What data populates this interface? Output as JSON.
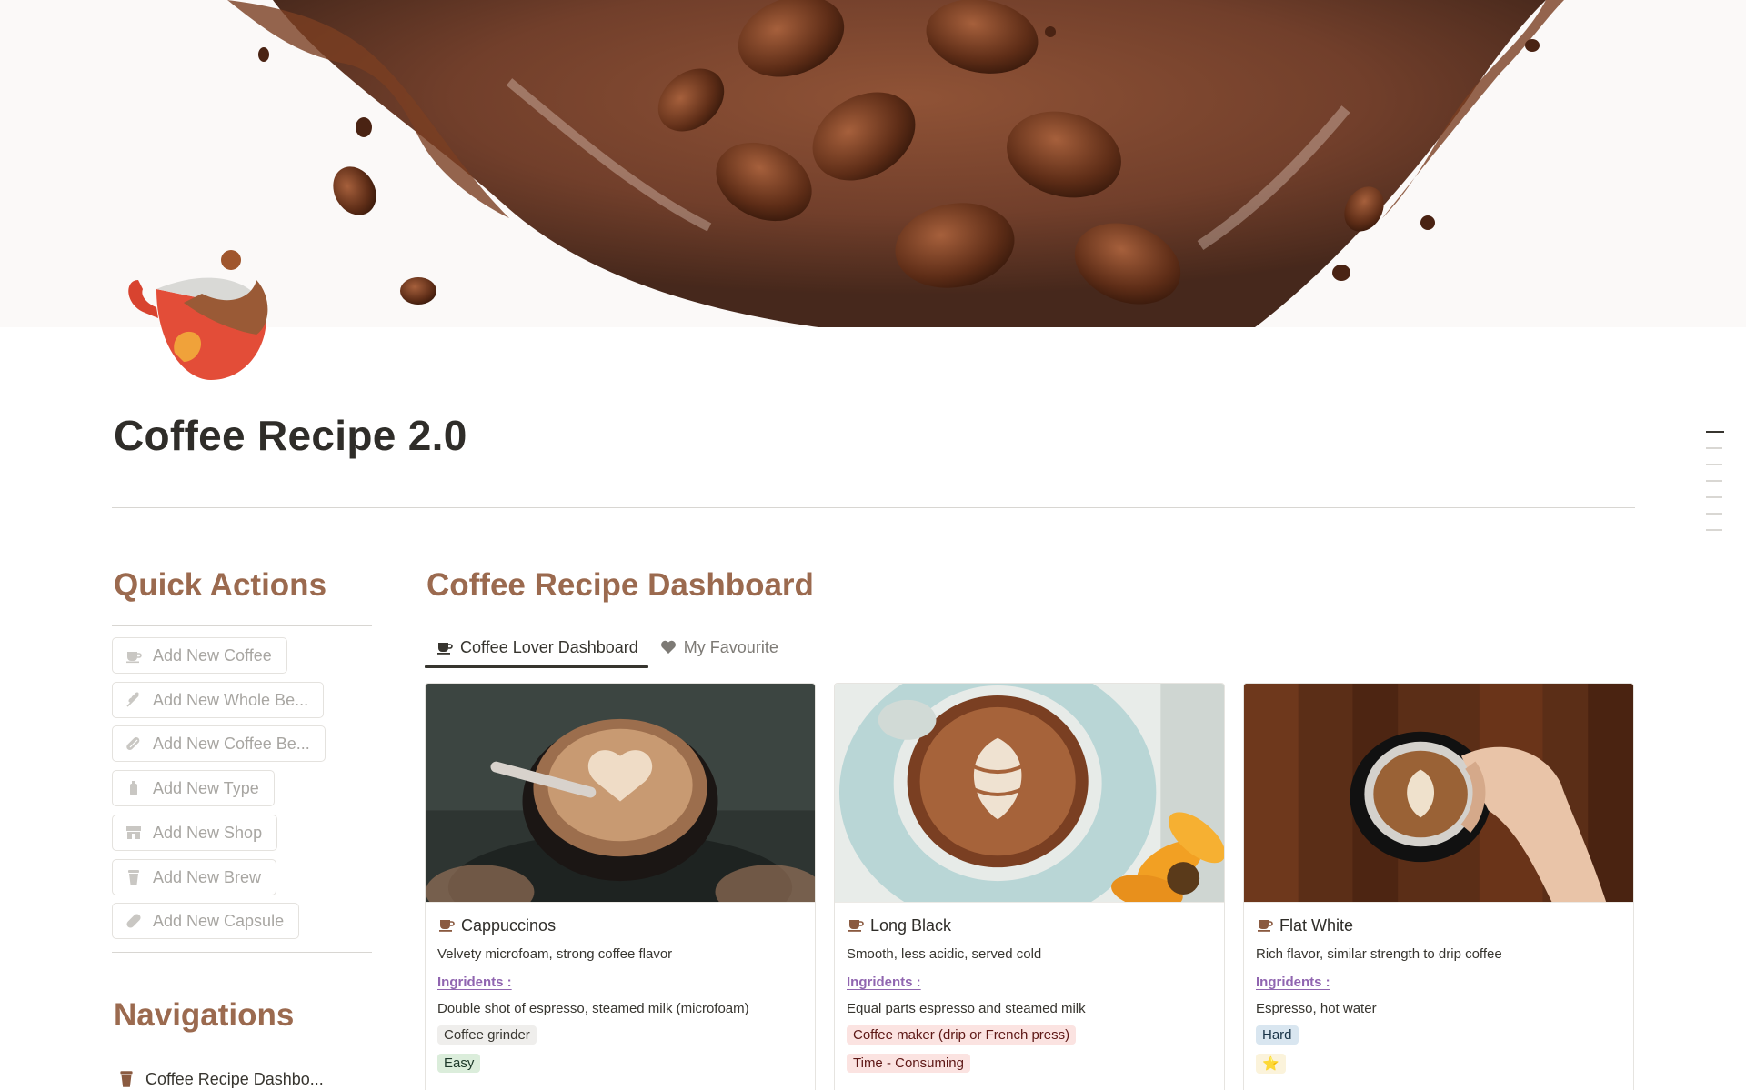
{
  "page": {
    "title": "Coffee Recipe 2.0"
  },
  "quick_actions": {
    "heading": "Quick Actions",
    "buttons": [
      {
        "label": "Add New Coffee",
        "icon": "coffee-cup-icon"
      },
      {
        "label": "Add New Whole Be...",
        "icon": "wheat-icon"
      },
      {
        "label": "Add New Coffee Be...",
        "icon": "capsule-bean-icon"
      },
      {
        "label": "Add New Type",
        "icon": "bottle-icon"
      },
      {
        "label": "Add New Shop",
        "icon": "shop-icon"
      },
      {
        "label": "Add New Brew",
        "icon": "brew-cup-icon"
      },
      {
        "label": "Add New Capsule",
        "icon": "capsule-icon"
      }
    ]
  },
  "navigations": {
    "heading": "Navigations",
    "items": [
      {
        "label": "Coffee Recipe Dashbo...",
        "icon": "brew-cup-icon"
      }
    ]
  },
  "dashboard": {
    "heading": "Coffee Recipe Dashboard",
    "tabs": [
      {
        "label": "Coffee Lover Dashboard",
        "icon": "coffee-cup-icon",
        "active": true
      },
      {
        "label": "My Favourite",
        "icon": "heart-icon",
        "active": false
      }
    ],
    "cards": [
      {
        "name": "Cappuccinos",
        "description": "Velvety microfoam, strong coffee flavor",
        "ingredients_label": "Ingridents  :",
        "ingredients": "Double shot of espresso, steamed milk (microfoam)",
        "tags": [
          {
            "label": "Coffee grinder",
            "color": "gray"
          },
          {
            "label": "Easy",
            "color": "green"
          }
        ]
      },
      {
        "name": "Long Black",
        "description": "Smooth, less acidic, served cold",
        "ingredients_label": "Ingridents  :",
        "ingredients": "Equal parts espresso and steamed milk",
        "tags": [
          {
            "label": "Coffee maker (drip or French press)",
            "color": "red"
          },
          {
            "label": "Time - Consuming",
            "color": "red"
          }
        ]
      },
      {
        "name": "Flat White",
        "description": "Rich flavor, similar strength to drip coffee",
        "ingredients_label": "Ingridents  :",
        "ingredients": "Espresso, hot water",
        "tags": [
          {
            "label": "Hard",
            "color": "blue"
          },
          {
            "label": "⭐",
            "color": "yellow"
          }
        ]
      }
    ]
  },
  "colors": {
    "heading_brown": "#9b6a4f",
    "ingredients_purple": "#9065b0",
    "title_dark": "#2f2d29"
  }
}
